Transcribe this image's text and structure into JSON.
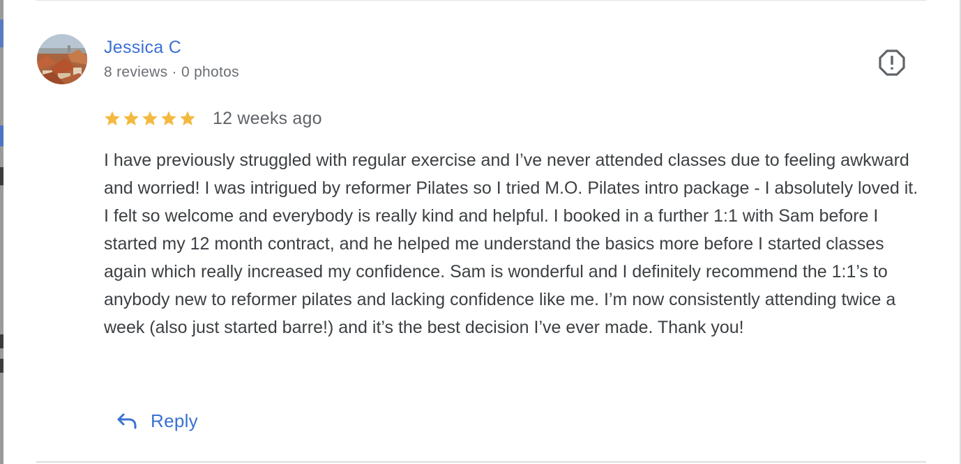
{
  "review": {
    "reviewer_name": "Jessica C",
    "reviewer_meta": "8 reviews · 0 photos",
    "rating": 5,
    "rating_max": 5,
    "time_ago": "12 weeks ago",
    "text": "I have previously struggled with regular exercise and I’ve never attended classes due to feeling awkward and worried! I was intrigued by reformer Pilates so I tried M.O. Pilates intro package - I absolutely loved it. I felt so welcome and everybody is really kind and helpful. I booked in a further 1:1 with Sam before I started my 12 month contract, and he helped me understand the basics more before I started classes again which really increased my confidence. Sam is wonderful and I definitely recommend the 1:1’s to anybody new to reformer pilates and lacking confidence like me. I’m now consistently attending twice a week (also just started barre!) and it’s the best decision I’ve ever made. Thank you!"
  },
  "actions": {
    "reply_label": "Reply"
  },
  "icons": {
    "avatar": "avatar-photo",
    "report": "report-icon",
    "star": "star-icon",
    "reply": "reply-arrow-icon"
  },
  "colors": {
    "link_blue": "#3a70d3",
    "star_gold": "#f4b93f",
    "meta_gray": "#6b6f74",
    "text_dark": "#3c4043",
    "icon_gray": "#5f6368"
  }
}
